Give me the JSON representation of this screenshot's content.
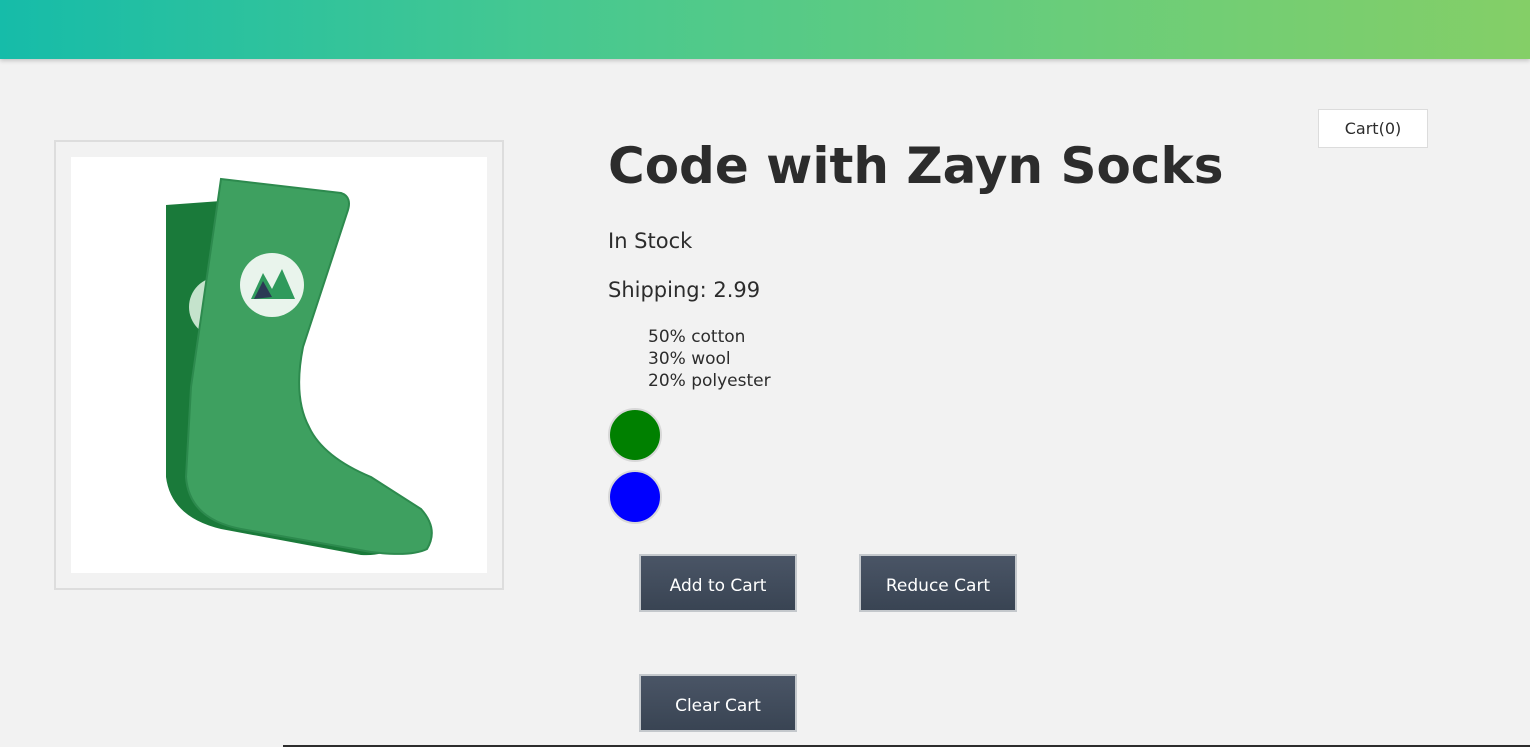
{
  "header": {
    "background_gradient": [
      "#16bca9",
      "#84cf67"
    ]
  },
  "cart": {
    "label": "Cart(0)"
  },
  "product": {
    "image_icon": "green-socks-image",
    "title": "Code with Zayn Socks",
    "stock_status": "In Stock",
    "shipping_label": "Shipping: 2.99",
    "details": [
      "50% cotton",
      "30% wool",
      "20% polyester"
    ],
    "variants": [
      {
        "color": "#008000"
      },
      {
        "color": "#0000ff"
      }
    ]
  },
  "actions": {
    "add_to_cart": "Add to Cart",
    "reduce_cart": "Reduce Cart",
    "clear_cart": "Clear Cart"
  }
}
